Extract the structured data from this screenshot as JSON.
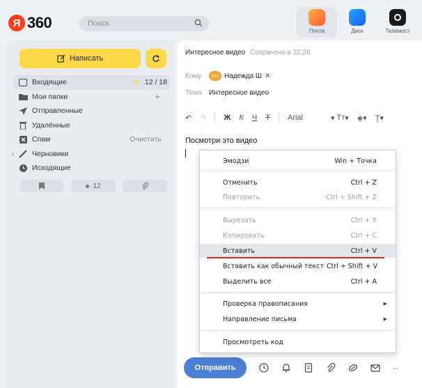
{
  "header": {
    "logo_letter": "Я",
    "logo_text": "360",
    "search_placeholder": "Поиск",
    "apps": [
      {
        "label": "Почта",
        "icon": "mail-icon"
      },
      {
        "label": "Диск",
        "icon": "disk-icon"
      },
      {
        "label": "Телемост",
        "icon": "telemost-icon"
      }
    ]
  },
  "sidebar": {
    "compose_label": "Написать",
    "folders": [
      {
        "label": "Входящие",
        "count": "12 / 18",
        "icon": "inbox-icon"
      },
      {
        "label": "Мои папки",
        "count": "+",
        "icon": "folder-icon"
      },
      {
        "label": "Отправленные",
        "count": "",
        "icon": "send-icon"
      },
      {
        "label": "Удалённые",
        "count": "",
        "icon": "trash-icon"
      },
      {
        "label": "Спам",
        "count": "Очистить",
        "icon": "spam-icon"
      },
      {
        "label": "Черновики",
        "count": "",
        "icon": "pencil-icon"
      },
      {
        "label": "Исходящие",
        "count": "",
        "icon": "clock-icon"
      }
    ],
    "filters": {
      "unread_count": "12"
    }
  },
  "compose": {
    "title": "Интересное видео",
    "saved_status": "Сохранено в 22:26",
    "to_label": "Кому",
    "recipient_initials": "НШ",
    "recipient_name": "Надежда Ш",
    "subject_label": "Тема",
    "subject_value": "Интересное видео",
    "toolbar": {
      "bold": "Ж",
      "italic": "К",
      "underline": "Ч",
      "strike": "Т",
      "font": "Arial",
      "size": "Тт"
    },
    "body_text": "Посмотри это видео",
    "send_label": "Отправить"
  },
  "context_menu": {
    "items": [
      {
        "label": "Эмодзи",
        "shortcut": "Win + Точка",
        "enabled": true
      },
      {
        "label": "Отменить",
        "shortcut": "Ctrl + Z",
        "enabled": true
      },
      {
        "label": "Повторить",
        "shortcut": "Ctrl + Shift + Z",
        "enabled": false
      },
      {
        "label": "Вырезать",
        "shortcut": "Ctrl + X",
        "enabled": false
      },
      {
        "label": "Копировать",
        "shortcut": "Ctrl + C",
        "enabled": false
      },
      {
        "label": "Вставить",
        "shortcut": "Ctrl + V",
        "enabled": true
      },
      {
        "label": "Вставить как обычный текст",
        "shortcut": "Ctrl + Shift + V",
        "enabled": true
      },
      {
        "label": "Выделить все",
        "shortcut": "Ctrl + A",
        "enabled": true
      },
      {
        "label": "Проверка правописания",
        "shortcut": "",
        "enabled": true
      },
      {
        "label": "Направление письма",
        "shortcut": "",
        "enabled": true
      },
      {
        "label": "Просмотреть код",
        "shortcut": "",
        "enabled": true
      }
    ],
    "highlight_color": "#e0242a"
  }
}
